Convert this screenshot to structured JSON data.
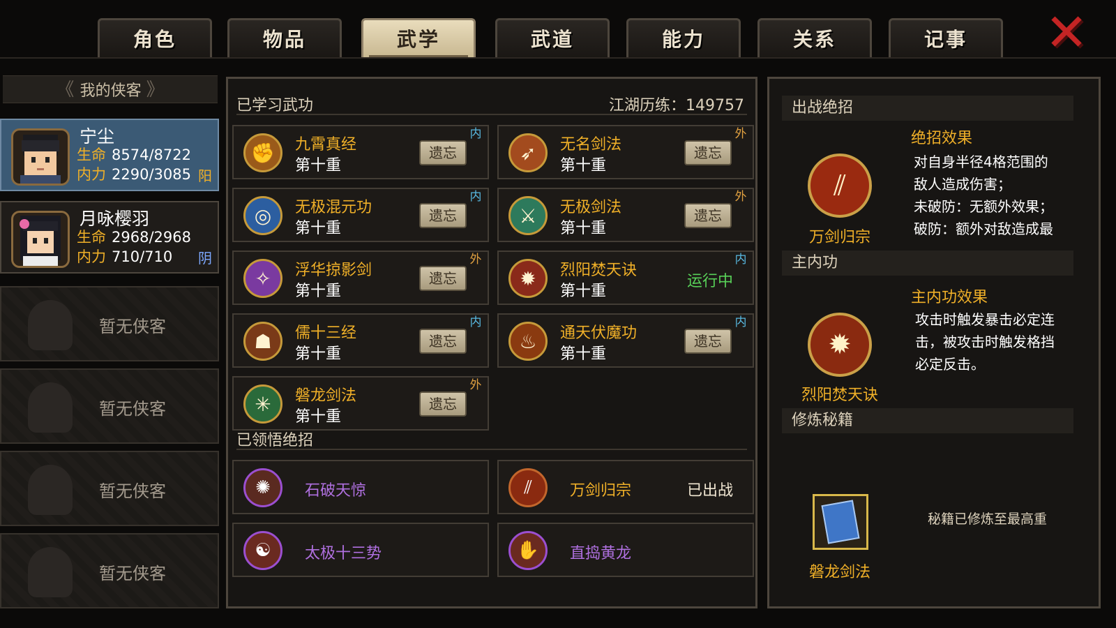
{
  "tabs": [
    {
      "label": "角色",
      "active": false
    },
    {
      "label": "物品",
      "active": false
    },
    {
      "label": "武学",
      "active": true
    },
    {
      "label": "武道",
      "active": false
    },
    {
      "label": "能力",
      "active": false
    },
    {
      "label": "关系",
      "active": false
    },
    {
      "label": "记事",
      "active": false
    }
  ],
  "close_icon": "close-x-icon",
  "sidebar": {
    "title": "我的侠客",
    "heroes": [
      {
        "name": "宁尘",
        "hp_label": "生命",
        "hp": "8574/8722",
        "mp_label": "内力",
        "mp": "2290/3085",
        "yinyang": "阳",
        "selected": true
      },
      {
        "name": "月咏樱羽",
        "hp_label": "生命",
        "hp": "2968/2968",
        "mp_label": "内力",
        "mp": "710/710",
        "yinyang": "阴",
        "selected": false
      }
    ],
    "empty_label": "暂无侠客"
  },
  "center": {
    "learned_title": "已学习武功",
    "exp_label": "江湖历练：149757",
    "skills": [
      {
        "name": "九霄真经",
        "level": "第十重",
        "action": "遗忘",
        "tag": "内",
        "icon": "claw-icon",
        "color": "#9a5a1a"
      },
      {
        "name": "无名剑法",
        "level": "第十重",
        "action": "遗忘",
        "tag": "外",
        "icon": "sword-icon",
        "color": "#a34b1e"
      },
      {
        "name": "无极混元功",
        "level": "第十重",
        "action": "遗忘",
        "tag": "内",
        "icon": "swirl-icon",
        "color": "#2c5ea0"
      },
      {
        "name": "无极剑法",
        "level": "第十重",
        "action": "遗忘",
        "tag": "外",
        "icon": "blade-icon",
        "color": "#2d7a5c"
      },
      {
        "name": "浮华掠影剑",
        "level": "第十重",
        "action": "遗忘",
        "tag": "外",
        "icon": "slash-icon",
        "color": "#7a3aa0"
      },
      {
        "name": "烈阳焚天诀",
        "level": "第十重",
        "action": "运行中",
        "tag": "内",
        "icon": "flame-icon",
        "color": "#8a2a1a"
      },
      {
        "name": "儒十三经",
        "level": "第十重",
        "action": "遗忘",
        "tag": "内",
        "icon": "scholar-icon",
        "color": "#7a3a18"
      },
      {
        "name": "通天伏魔功",
        "level": "第十重",
        "action": "遗忘",
        "tag": "内",
        "icon": "fire-icon",
        "color": "#8a3a10"
      },
      {
        "name": "磐龙剑法",
        "level": "第十重",
        "action": "遗忘",
        "tag": "外",
        "icon": "burst-icon",
        "color": "#2a6a3a"
      }
    ],
    "ultimates_title": "已领悟绝招",
    "ultimates": [
      {
        "name": "石破天惊",
        "status": "",
        "icon": "explosion-icon",
        "color": "#b070e0",
        "ring": "purple"
      },
      {
        "name": "万剑归宗",
        "status": "已出战",
        "icon": "swords-icon",
        "color": "#f0b028",
        "ring": "orange"
      },
      {
        "name": "太极十三势",
        "status": "",
        "icon": "taiji-icon",
        "color": "#b070e0",
        "ring": "purple"
      },
      {
        "name": "直捣黄龙",
        "status": "",
        "icon": "strike-icon",
        "color": "#b070e0",
        "ring": "purple"
      }
    ]
  },
  "right": {
    "ultimate_section": "出战绝招",
    "ultimate_name": "万剑归宗",
    "ultimate_effect_title": "绝招效果",
    "ultimate_effect_lines": [
      "对自身半径4格范围的",
      "敌人造成伤害；",
      "未破防：无额外效果；",
      "破防：额外对敌造成最"
    ],
    "inner_section": "主内功",
    "inner_name": "烈阳焚天诀",
    "inner_effect_title": "主内功效果",
    "inner_effect_lines": [
      "攻击时触发暴击必定连",
      "击，被攻击时触发格挡",
      "必定反击。"
    ],
    "manual_section": "修炼秘籍",
    "manual_name": "磐龙剑法",
    "manual_note": "秘籍已修炼至最高重"
  }
}
